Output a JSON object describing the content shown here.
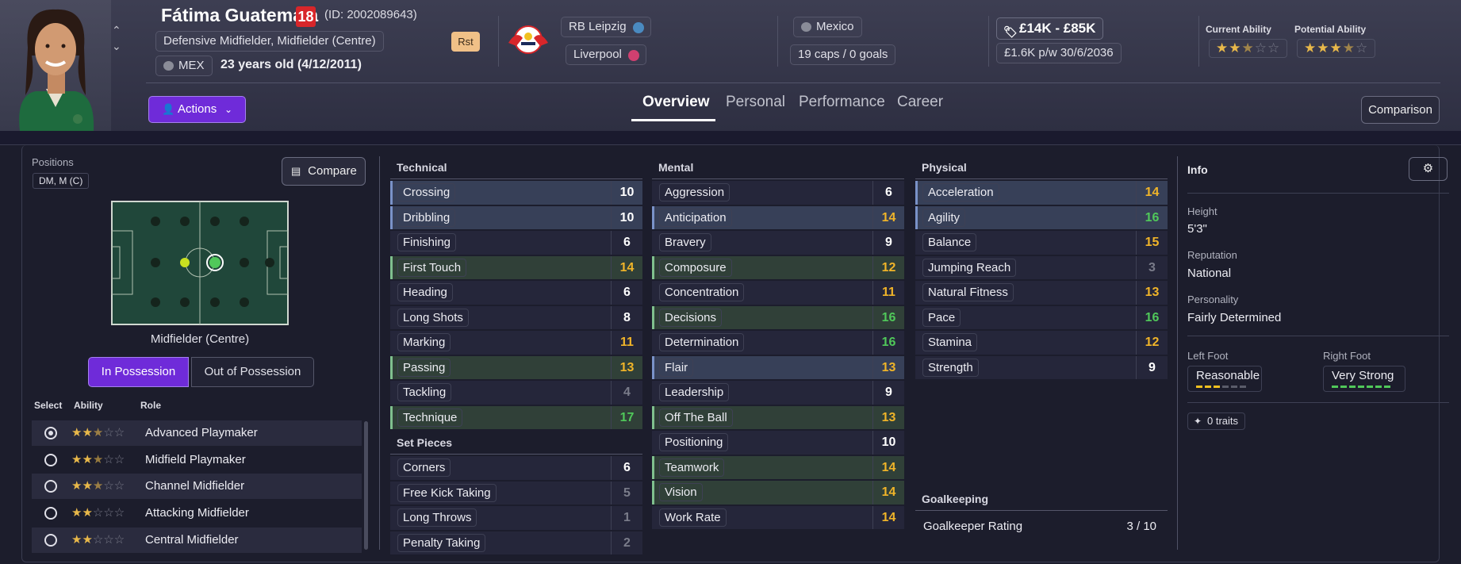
{
  "player": {
    "name": "Fátima Guatemala",
    "number": "18",
    "id": "(ID: 2002089643)",
    "positions_text": "Defensive Midfielder, Midfielder (Centre)",
    "nation": "MEX",
    "age": "23 years old (4/12/2011)",
    "status_badge": "Rst"
  },
  "clubs": {
    "club": "RB Leipzig",
    "loan_club": "Liverpool"
  },
  "international": {
    "country": "Mexico",
    "caps": "19 caps / 0 goals"
  },
  "contract": {
    "value": "£14K - £85K",
    "wage": "£1.6K p/w 30/6/2036"
  },
  "ability": {
    "current_label": "Current Ability",
    "potential_label": "Potential Ability",
    "current_stars": 2.5,
    "potential_stars": 3.5
  },
  "actions_label": "Actions",
  "tabs": [
    "Overview",
    "Personal",
    "Performance",
    "Career"
  ],
  "comparison_label": "Comparison",
  "positions_panel": {
    "title": "Positions",
    "value": "DM, M (C)",
    "compare_label": "Compare",
    "selected_position": "Midfielder (Centre)",
    "in_possession": "In Possession",
    "out_possession": "Out of Possession"
  },
  "roles": {
    "headers": [
      "Select",
      "Ability",
      "Role"
    ],
    "items": [
      {
        "name": "Advanced Playmaker",
        "stars": 2.5,
        "selected": true
      },
      {
        "name": "Midfield Playmaker",
        "stars": 2.5,
        "selected": false
      },
      {
        "name": "Channel Midfielder",
        "stars": 2.5,
        "selected": false
      },
      {
        "name": "Attacking Midfielder",
        "stars": 2,
        "selected": false
      },
      {
        "name": "Central Midfielder",
        "stars": 2,
        "selected": false
      }
    ]
  },
  "attributes": {
    "technical_title": "Technical",
    "technical": [
      {
        "name": "Crossing",
        "value": "10"
      },
      {
        "name": "Dribbling",
        "value": "10"
      },
      {
        "name": "Finishing",
        "value": "6"
      },
      {
        "name": "First Touch",
        "value": "14"
      },
      {
        "name": "Heading",
        "value": "6"
      },
      {
        "name": "Long Shots",
        "value": "8"
      },
      {
        "name": "Marking",
        "value": "11"
      },
      {
        "name": "Passing",
        "value": "13"
      },
      {
        "name": "Tackling",
        "value": "4"
      },
      {
        "name": "Technique",
        "value": "17"
      }
    ],
    "set_pieces_title": "Set Pieces",
    "set_pieces": [
      {
        "name": "Corners",
        "value": "6"
      },
      {
        "name": "Free Kick Taking",
        "value": "5"
      },
      {
        "name": "Long Throws",
        "value": "1"
      },
      {
        "name": "Penalty Taking",
        "value": "2"
      }
    ],
    "mental_title": "Mental",
    "mental": [
      {
        "name": "Aggression",
        "value": "6"
      },
      {
        "name": "Anticipation",
        "value": "14"
      },
      {
        "name": "Bravery",
        "value": "9"
      },
      {
        "name": "Composure",
        "value": "12"
      },
      {
        "name": "Concentration",
        "value": "11"
      },
      {
        "name": "Decisions",
        "value": "16"
      },
      {
        "name": "Determination",
        "value": "16"
      },
      {
        "name": "Flair",
        "value": "13"
      },
      {
        "name": "Leadership",
        "value": "9"
      },
      {
        "name": "Off The Ball",
        "value": "13"
      },
      {
        "name": "Positioning",
        "value": "10"
      },
      {
        "name": "Teamwork",
        "value": "14"
      },
      {
        "name": "Vision",
        "value": "14"
      },
      {
        "name": "Work Rate",
        "value": "14"
      }
    ],
    "physical_title": "Physical",
    "physical": [
      {
        "name": "Acceleration",
        "value": "14"
      },
      {
        "name": "Agility",
        "value": "16"
      },
      {
        "name": "Balance",
        "value": "15"
      },
      {
        "name": "Jumping Reach",
        "value": "3"
      },
      {
        "name": "Natural Fitness",
        "value": "13"
      },
      {
        "name": "Pace",
        "value": "16"
      },
      {
        "name": "Stamina",
        "value": "12"
      },
      {
        "name": "Strength",
        "value": "9"
      }
    ],
    "goalkeeping_title": "Goalkeeping",
    "gk_rating_label": "Goalkeeper Rating",
    "gk_rating_value": "3 / 10"
  },
  "info": {
    "title": "Info",
    "height_label": "Height",
    "height": "5'3\"",
    "reputation_label": "Reputation",
    "reputation": "National",
    "personality_label": "Personality",
    "personality": "Fairly Determined",
    "left_foot_label": "Left Foot",
    "left_foot": "Reasonable",
    "right_foot_label": "Right Foot",
    "right_foot": "Very Strong",
    "traits": "0 traits"
  },
  "colors": {
    "accent": "#6f2bd9",
    "high": "#50c85a",
    "mid": "#f0b429",
    "low": "#7a7c8a"
  }
}
